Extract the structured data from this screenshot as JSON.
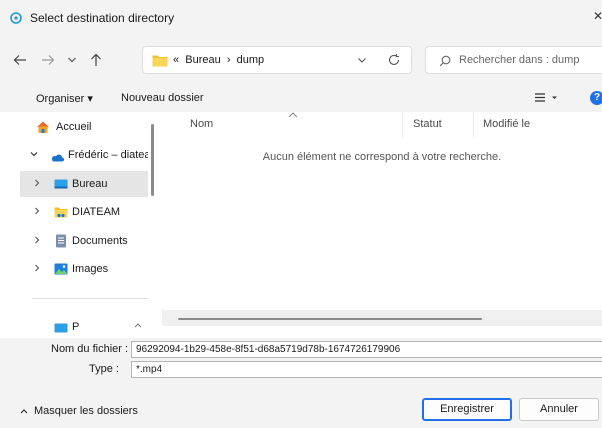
{
  "window": {
    "title": "Select destination directory"
  },
  "address": {
    "separator": "«",
    "path": [
      "Bureau",
      "dump"
    ],
    "path_divider": "›"
  },
  "search": {
    "placeholder": "Rechercher dans : dump"
  },
  "toolbar": {
    "organize_label": "Organiser ▾",
    "new_folder_label": "Nouveau dossier"
  },
  "sidebar": {
    "items": [
      {
        "label": "Accueil",
        "icon": "home-icon"
      },
      {
        "label": "Frédéric – diatea",
        "icon": "onedrive-cloud-icon",
        "expanded": true
      },
      {
        "label": "Bureau",
        "icon": "desktop-folder-icon",
        "selected": true
      },
      {
        "label": "DIATEAM",
        "icon": "folder-icon"
      },
      {
        "label": "Documents",
        "icon": "documents-icon"
      },
      {
        "label": "Images",
        "icon": "images-icon"
      },
      {
        "label": "P",
        "icon": "desktop-folder-icon"
      }
    ]
  },
  "columns": [
    "Nom",
    "Statut",
    "Modifié le"
  ],
  "empty_message": "Aucun élément ne correspond à votre recherche.",
  "filename": {
    "label": "Nom du fichier :",
    "value": "96292094-1b29-458e-8f51-d68a5719d78b-1674726179906"
  },
  "filetype": {
    "label": "Type :",
    "value": "*.mp4"
  },
  "footer": {
    "toggle_label": "Masquer les dossiers",
    "save_label": "Enregistrer",
    "cancel_label": "Annuler"
  },
  "colors": {
    "accent": "#1f6fe8",
    "chrome": "#f3f3f3",
    "folder": "#f2c12e"
  }
}
